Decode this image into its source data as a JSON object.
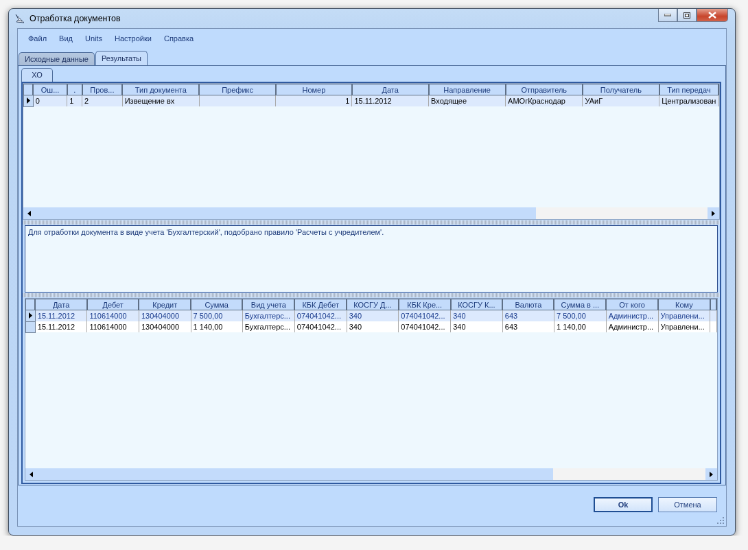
{
  "window": {
    "title": "Отработка документов"
  },
  "menu": [
    "Файл",
    "Вид",
    "Units",
    "Настройки",
    "Справка"
  ],
  "tabs": [
    {
      "label": "Исходные данные",
      "selected": false
    },
    {
      "label": "Результаты",
      "selected": true
    }
  ],
  "sub_tabs": [
    {
      "label": "ХО",
      "selected": true
    }
  ],
  "documents_table": {
    "columns": [
      {
        "label": "Ош...",
        "kind": "text"
      },
      {
        "label": ".",
        "kind": "text"
      },
      {
        "label": "Пров...",
        "kind": "text"
      },
      {
        "label": "Тип документа",
        "kind": "text"
      },
      {
        "label": "Префикс",
        "kind": "text"
      },
      {
        "label": "Номер",
        "kind": "number"
      },
      {
        "label": "Дата",
        "kind": "text"
      },
      {
        "label": "Направление",
        "kind": "text"
      },
      {
        "label": "Отправитель",
        "kind": "text"
      },
      {
        "label": "Получатель",
        "kind": "text"
      },
      {
        "label": "Тип передач",
        "kind": "text"
      }
    ],
    "rows": [
      {
        "selected": true,
        "cells": [
          "0",
          "1",
          "2",
          "Извещение вх",
          "",
          "1",
          "15.11.2012",
          "Входящее",
          "АМОгКраснодар",
          "УАиГ",
          "Централизован"
        ]
      }
    ]
  },
  "message": "Для отработки документа в виде учета 'Бухгалтерский', подобрано правило 'Расчеты с учредителем'.",
  "entries_table": {
    "columns": [
      "Дата",
      "Дебет",
      "Кредит",
      "Сумма",
      "Вид учета",
      "КБК Дебет",
      "КОСГУ Д...",
      "КБК Кре...",
      "КОСГУ К...",
      "Валюта",
      "Сумма в ...",
      "От кого",
      "Кому"
    ],
    "rows": [
      {
        "selected": true,
        "cells": [
          "15.11.2012",
          "110614000",
          "130404000",
          "7 500,00",
          "Бухгалтерс...",
          "074041042...",
          "340",
          "074041042...",
          "340",
          "643",
          "7 500,00",
          "Администр...",
          "Управлени..."
        ]
      },
      {
        "selected": false,
        "cells": [
          "15.11.2012",
          "110614000",
          "130404000",
          "1 140,00",
          "Бухгалтерс...",
          "074041042...",
          "340",
          "074041042...",
          "340",
          "643",
          "1 140,00",
          "Администр...",
          "Управлени..."
        ]
      }
    ]
  },
  "buttons": [
    {
      "label": "Ok",
      "default": true
    },
    {
      "label": "Отмена",
      "default": false
    }
  ]
}
